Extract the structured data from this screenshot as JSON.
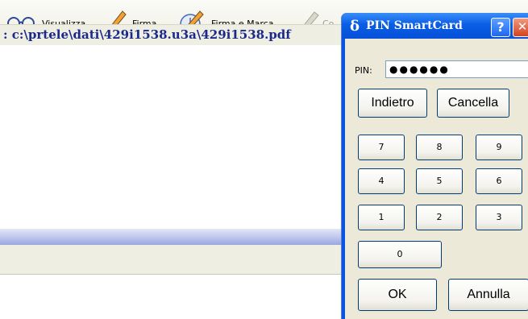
{
  "toolbar": {
    "buttons": [
      {
        "label": "Visualizza",
        "icon": "glasses-icon"
      },
      {
        "label": "Firma",
        "icon": "pen-icon"
      },
      {
        "label": "Firma e Marca",
        "icon": "pen-clock-icon"
      },
      {
        "label": "Co",
        "icon": "verify-pen-icon"
      }
    ]
  },
  "file_path": ": c:\\prtele\\dati\\429i1538.u3a\\429i1538.pdf",
  "dialog": {
    "title": "PIN SmartCard",
    "title_icon": "δ",
    "help_label": "?",
    "close_label": "✕",
    "pin_label": "PIN:",
    "pin_value": "●●●●●●",
    "back_label": "Indietro",
    "clear_label": "Cancella",
    "keys": [
      "7",
      "8",
      "9",
      "4",
      "5",
      "6",
      "1",
      "2",
      "3",
      "0"
    ],
    "ok_label": "OK",
    "cancel_label": "Annulla"
  }
}
